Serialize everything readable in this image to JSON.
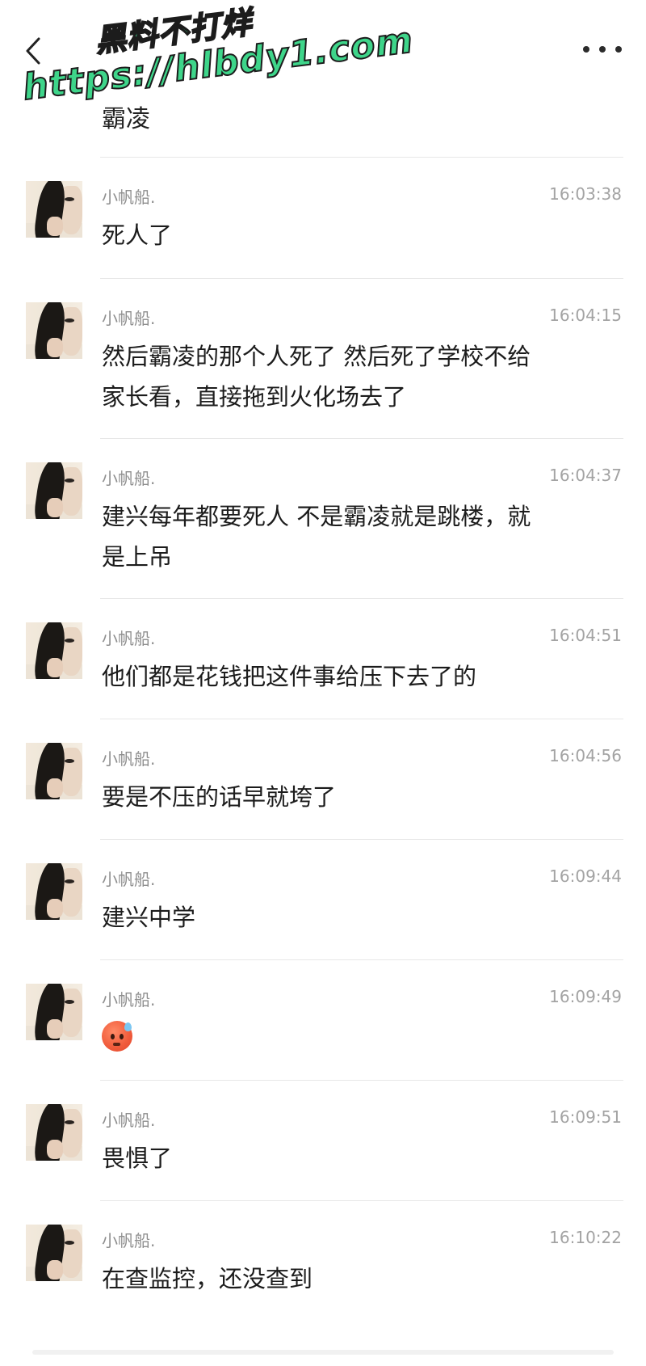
{
  "header": {
    "back_icon": "chevron-left-icon",
    "more_icon": "more-horizontal-icon"
  },
  "watermark": {
    "line1": "黑料不打烊",
    "line2": "https://hlbdy1.com"
  },
  "partial_message": {
    "text": "霸凌"
  },
  "messages": [
    {
      "sender": "小帆船.",
      "time": "16:03:38",
      "lines": [
        "死人了"
      ]
    },
    {
      "sender": "小帆船.",
      "time": "16:04:15",
      "lines": [
        "然后霸凌的那个人死了  然后死了学校不给",
        "家长看，直接拖到火化场去了"
      ]
    },
    {
      "sender": "小帆船.",
      "time": "16:04:37",
      "lines": [
        "建兴每年都要死人  不是霸凌就是跳楼，就",
        "是上吊"
      ]
    },
    {
      "sender": "小帆船.",
      "time": "16:04:51",
      "lines": [
        "他们都是花钱把这件事给压下去了的"
      ]
    },
    {
      "sender": "小帆船.",
      "time": "16:04:56",
      "lines": [
        "要是不压的话早就垮了"
      ]
    },
    {
      "sender": "小帆船.",
      "time": "16:09:44",
      "lines": [
        "建兴中学"
      ]
    },
    {
      "sender": "小帆船.",
      "time": "16:09:49",
      "emoji": "anxious-sweat-face-emoji"
    },
    {
      "sender": "小帆船.",
      "time": "16:09:51",
      "lines": [
        "畏惧了"
      ]
    },
    {
      "sender": "小帆船.",
      "time": "16:10:22",
      "lines": [
        "在查监控，还没查到"
      ]
    }
  ]
}
